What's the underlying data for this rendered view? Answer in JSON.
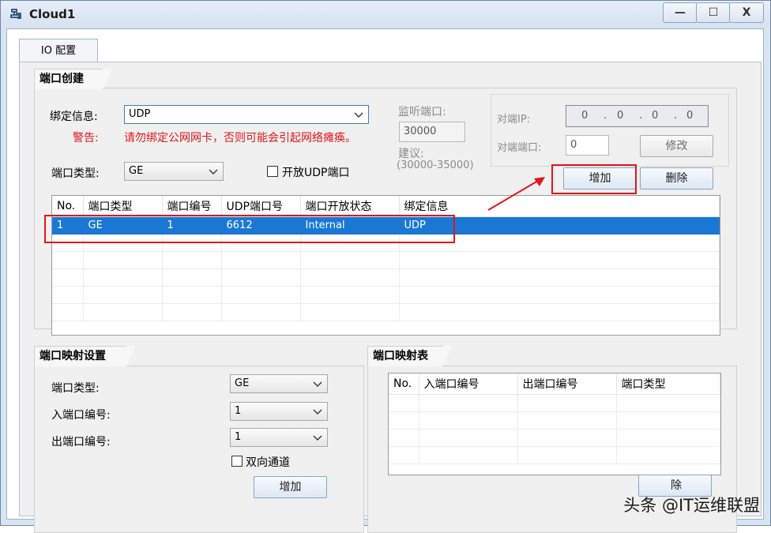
{
  "window": {
    "title": "Cloud1",
    "minimize": "—",
    "maximize": "☐",
    "close": "X"
  },
  "tab": {
    "label": "IO 配置"
  },
  "port_create": {
    "group_title": "端口创建",
    "binding_label": "绑定信息:",
    "binding_value": "UDP",
    "warning_label": "警告:",
    "warning_text": "请勿绑定公网网卡，否则可能会引起网络瘫痪。",
    "port_type_label": "端口类型:",
    "port_type_value": "GE",
    "open_udp_label": "开放UDP端口",
    "listen_port_label": "监听端口:",
    "listen_port_value": "30000",
    "suggest_label": "建议:",
    "suggest_range": "(30000-35000)",
    "peer_ip_label": "对端IP:",
    "peer_ip": [
      "0",
      "0",
      "0",
      "0"
    ],
    "peer_ip_dots": ".",
    "peer_port_label": "对端端口:",
    "peer_port_value": "0",
    "modify_button": "修改",
    "add_button": "增加",
    "delete_button": "删除",
    "table": {
      "headers": [
        "No.",
        "端口类型",
        "端口编号",
        "UDP端口号",
        "端口开放状态",
        "绑定信息"
      ],
      "rows": [
        [
          "1",
          "GE",
          "1",
          "6612",
          "Internal",
          "UDP"
        ]
      ]
    }
  },
  "port_map_settings": {
    "group_title": "端口映射设置",
    "port_type_label": "端口类型:",
    "port_type_value": "GE",
    "in_port_label": "入端口编号:",
    "in_port_value": "1",
    "out_port_label": "出端口编号:",
    "out_port_value": "1",
    "bidirectional_label": "双向通道",
    "add_button": "增加"
  },
  "port_map_table": {
    "group_title": "端口映射表",
    "headers": [
      "No.",
      "入端口编号",
      "出端口编号",
      "端口类型"
    ],
    "delete_button_partial": "除"
  },
  "watermark": {
    "text": "头条 @IT运维联盟"
  },
  "colors": {
    "selection": "#1a78d4",
    "warning": "#e0161b",
    "annotation": "#e0161b"
  }
}
